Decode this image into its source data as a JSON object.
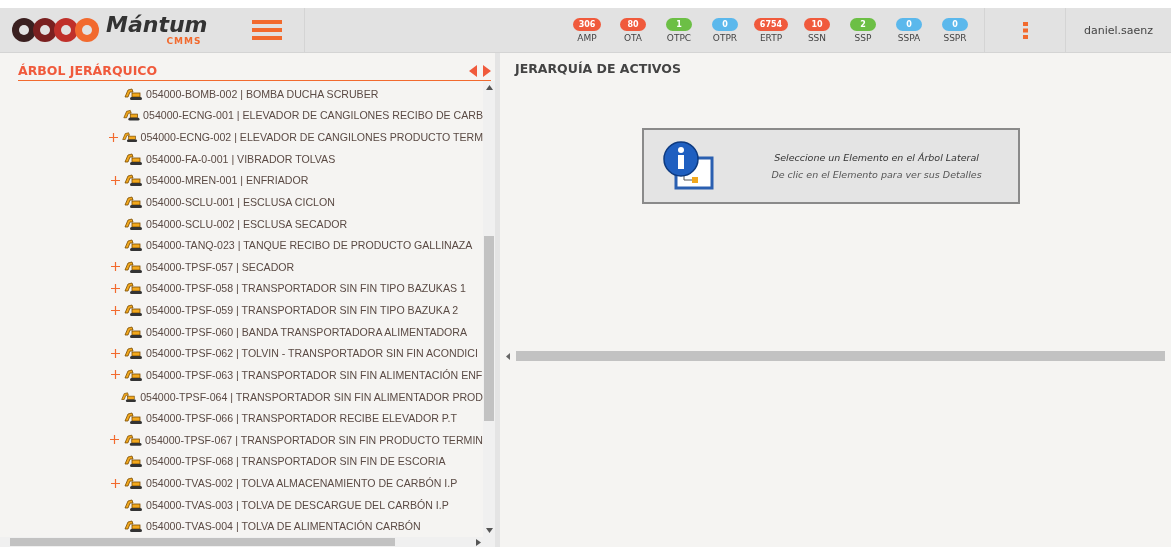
{
  "header": {
    "logo": {
      "name": "Mántum",
      "sub": "CMMS"
    },
    "counters": [
      {
        "value": "306",
        "label": "AMP",
        "color": "#f05a3c"
      },
      {
        "value": "80",
        "label": "OTA",
        "color": "#f05a3c"
      },
      {
        "value": "1",
        "label": "OTPC",
        "color": "#6cbf45"
      },
      {
        "value": "0",
        "label": "OTPR",
        "color": "#5bb8ec"
      },
      {
        "value": "6754",
        "label": "ERTP",
        "color": "#f05a3c"
      },
      {
        "value": "10",
        "label": "SSN",
        "color": "#f05a3c"
      },
      {
        "value": "2",
        "label": "SSP",
        "color": "#6cbf45"
      },
      {
        "value": "0",
        "label": "SSPA",
        "color": "#5bb8ec"
      },
      {
        "value": "0",
        "label": "SSPR",
        "color": "#5bb8ec"
      }
    ],
    "user": "daniel.saenz"
  },
  "tree": {
    "title": "ÁRBOL JERÁRQUICO",
    "items": [
      {
        "text": "054000-BOMB-002 | BOMBA DUCHA SCRUBER",
        "expandable": false
      },
      {
        "text": "054000-ECNG-001 | ELEVADOR DE CANGILONES RECIBO DE CARB",
        "expandable": false
      },
      {
        "text": "054000-ECNG-002 | ELEVADOR DE CANGILONES PRODUCTO TERM",
        "expandable": true
      },
      {
        "text": "054000-FA-0-001 | VIBRADOR TOLVAS",
        "expandable": false
      },
      {
        "text": "054000-MREN-001 | ENFRIADOR",
        "expandable": true
      },
      {
        "text": "054000-SCLU-001 | ESCLUSA CICLON",
        "expandable": false
      },
      {
        "text": "054000-SCLU-002 | ESCLUSA SECADOR",
        "expandable": false
      },
      {
        "text": "054000-TANQ-023 | TANQUE RECIBO DE PRODUCTO GALLINAZA",
        "expandable": false
      },
      {
        "text": "054000-TPSF-057 | SECADOR",
        "expandable": true
      },
      {
        "text": "054000-TPSF-058 | TRANSPORTADOR SIN FIN TIPO BAZUKAS 1",
        "expandable": true
      },
      {
        "text": "054000-TPSF-059 | TRANSPORTADOR SIN FIN TIPO BAZUKA 2",
        "expandable": true
      },
      {
        "text": "054000-TPSF-060 | BANDA TRANSPORTADORA ALIMENTADORA",
        "expandable": false
      },
      {
        "text": "054000-TPSF-062 | TOLVIN - TRANSPORTADOR SIN FIN ACONDICI",
        "expandable": true
      },
      {
        "text": "054000-TPSF-063 | TRANSPORTADOR SIN FIN ALIMENTACIÓN ENF",
        "expandable": true
      },
      {
        "text": "054000-TPSF-064 | TRANSPORTADOR SIN FIN ALIMENTADOR PROD",
        "expandable": false
      },
      {
        "text": "054000-TPSF-066 | TRANSPORTADOR RECIBE ELEVADOR P.T",
        "expandable": false
      },
      {
        "text": "054000-TPSF-067 | TRANSPORTADOR SIN FIN PRODUCTO TERMIN",
        "expandable": true
      },
      {
        "text": "054000-TPSF-068 | TRANSPORTADOR SIN FIN DE ESCORIA",
        "expandable": false
      },
      {
        "text": "054000-TVAS-002 | TOLVA ALMACENAMIENTO DE CARBÓN I.P",
        "expandable": true
      },
      {
        "text": "054000-TVAS-003 | TOLVA DE DESCARGUE DEL CARBÓN I.P",
        "expandable": false
      },
      {
        "text": "054000-TVAS-004 | TOLVA DE ALIMENTACIÓN CARBÓN",
        "expandable": false
      }
    ]
  },
  "detail": {
    "title": "JERARQUÍA DE ACTIVOS",
    "notice": {
      "line_1": "Seleccione un Elemento en el Árbol Lateral",
      "line_2": "De clic en el Elemento para ver sus Detalles"
    }
  }
}
